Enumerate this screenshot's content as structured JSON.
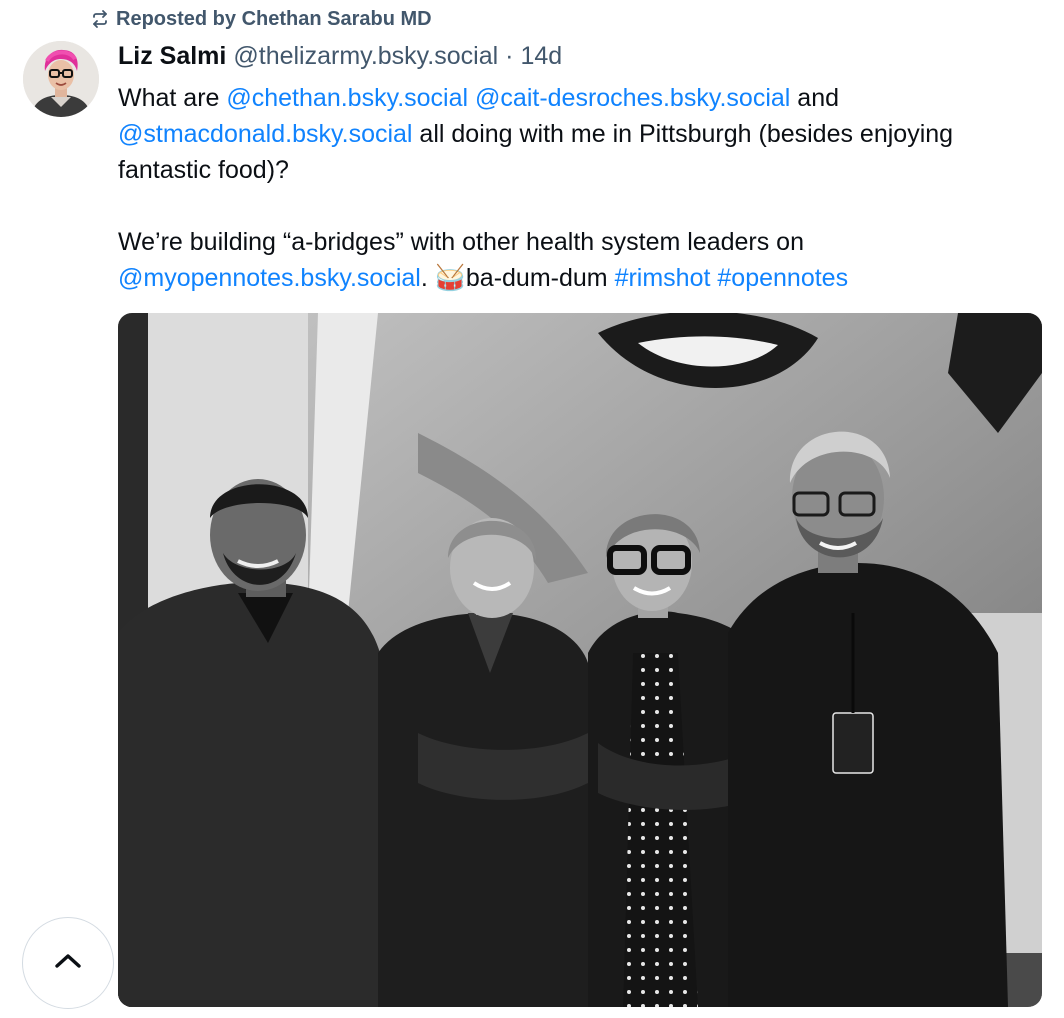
{
  "repost": {
    "icon": "repost-icon",
    "label": "Reposted by Chethan Sarabu MD"
  },
  "post": {
    "author": {
      "avatar_icon": "user-avatar",
      "name": "Liz Salmi",
      "handle": "@thelizarmy.bsky.social",
      "separator": "·",
      "age": "14d"
    },
    "text": {
      "p1": {
        "t1": "What are ",
        "m1": "@chethan.bsky.social",
        "t2": " ",
        "m2": "@cait-desroches.bsky.social",
        "t3": " and ",
        "m3": "@stmacdonald.bsky.social",
        "t4": " all doing with me in Pittsburgh (besides enjoying fantastic food)?"
      },
      "p2": {
        "t1": "We’re building “a-bridges” with other health system leaders on ",
        "m1": "@myopennotes.bsky.social",
        "t2": ". ",
        "emoji": "🥁",
        "t3": "ba-dum-dum ",
        "h1": "#rimshot",
        "t4": " ",
        "h2": "#opennotes"
      }
    },
    "image_icon": "photo-image"
  },
  "scroll_top_icon": "chevron-up-icon",
  "colors": {
    "link": "#1083fe",
    "muted": "#42576c",
    "text": "#0b0f14",
    "border": "#d4dbe2"
  }
}
